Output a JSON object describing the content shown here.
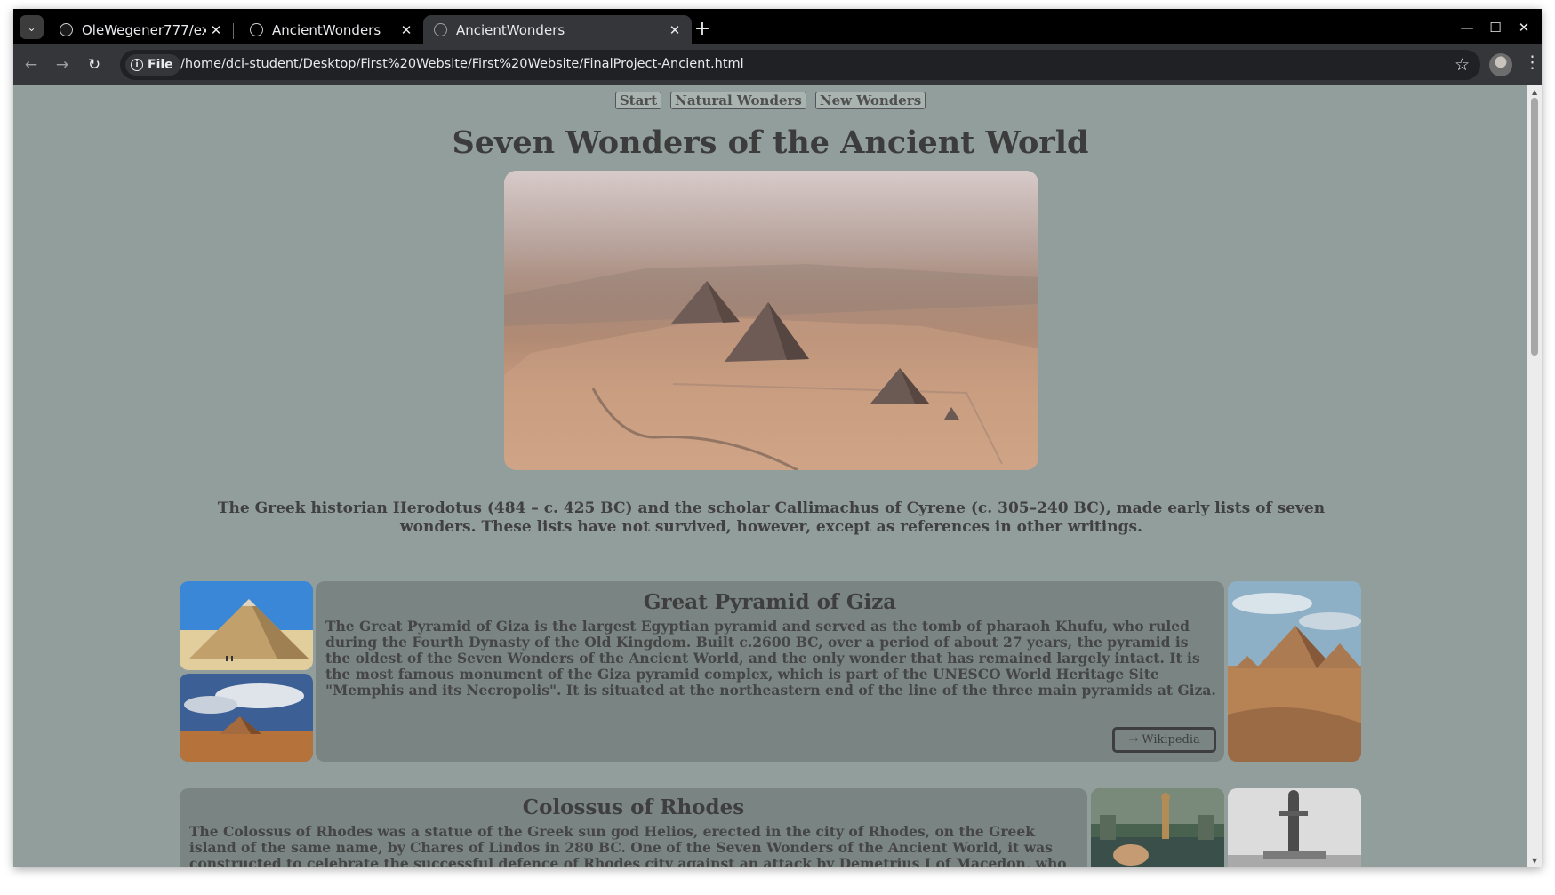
{
  "browser": {
    "tabs": [
      {
        "title": "OleWegener777/exercis",
        "active": false
      },
      {
        "title": "AncientWonders",
        "active": false
      },
      {
        "title": "AncientWonders",
        "active": true
      }
    ],
    "url_scheme_label": "File",
    "url": "/home/dci-student/Desktop/First%20Website/First%20Website/FinalProject-Ancient.html"
  },
  "site": {
    "nav": [
      "Start",
      "Natural Wonders",
      "New Wonders"
    ],
    "title": "Seven Wonders of the Ancient World",
    "intro": "The Greek historian Herodotus (484 – c. 425 BC) and the scholar Callimachus of Cyrene (c. 305–240 BC), made early lists of seven wonders. These lists have not survived, however, except as references in other writings.",
    "wonders": [
      {
        "title": "Great Pyramid of Giza",
        "text": "The Great Pyramid of Giza is the largest Egyptian pyramid and served as the tomb of pharaoh Khufu, who ruled during the Fourth Dynasty of the Old Kingdom. Built c.2600 BC, over a period of about 27 years, the pyramid is the oldest of the Seven Wonders of the Ancient World, and the only wonder that has remained largely intact. It is the most famous monument of the Giza pyramid complex, which is part of the UNESCO World Heritage Site \"Memphis and its Necropolis\". It is situated at the northeastern end of the line of the three main pyramids at Giza.",
        "link": "→ Wikipedia"
      },
      {
        "title": "Colossus of Rhodes",
        "text": "The Colossus of Rhodes was a statue of the Greek sun god Helios, erected in the city of Rhodes, on the Greek island of the same name, by Chares of Lindos in 280 BC. One of the Seven Wonders of the Ancient World, it was constructed to celebrate the successful defence of Rhodes city against an attack by Demetrius I of Macedon, who had besieged it for a year with a large army and navy."
      }
    ]
  },
  "colors": {
    "page_bg": "#929e9c",
    "card_bg": "#7a8583",
    "text": "#404040",
    "browser_dark": "#202124"
  },
  "icons": [
    "tab-search-icon",
    "github-icon",
    "globe-icon",
    "close-icon",
    "new-tab-icon",
    "minimize-icon",
    "maximize-icon",
    "window-close-icon",
    "back-icon",
    "forward-icon",
    "reload-icon",
    "info-icon",
    "star-icon",
    "profile-avatar",
    "menu-icon"
  ]
}
